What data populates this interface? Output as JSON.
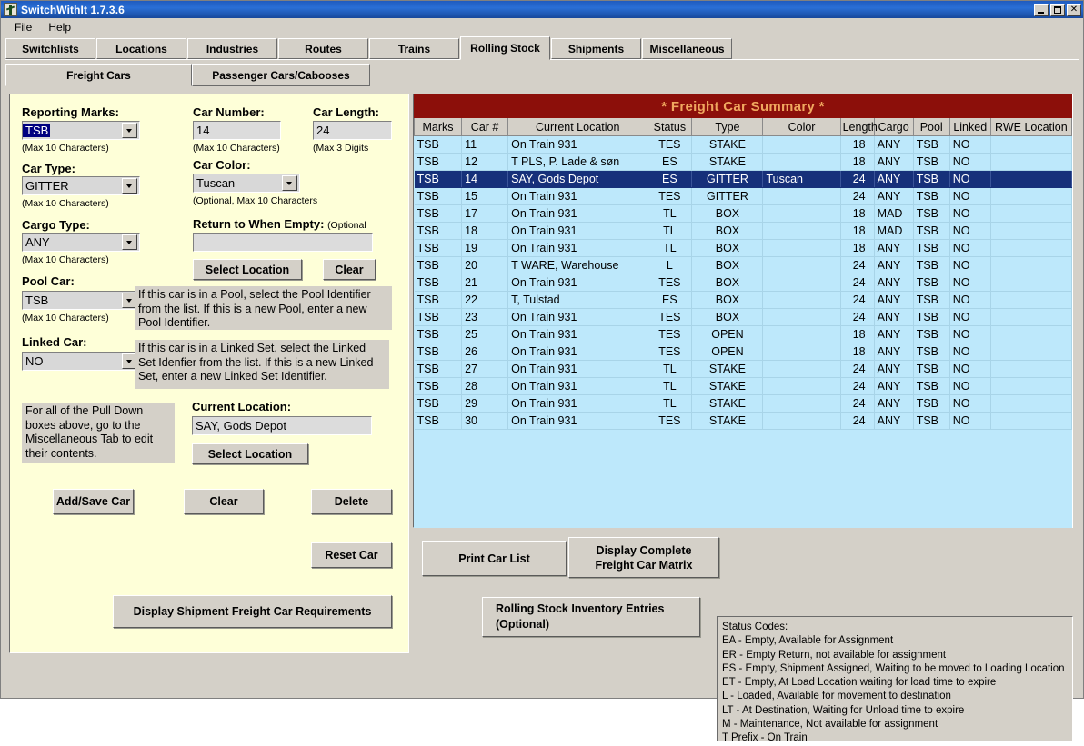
{
  "window": {
    "title": "SwitchWithIt 1.7.3.6",
    "icon": "app-icon",
    "buttons": {
      "minimize": "_",
      "maximize": "□",
      "close": "✕"
    }
  },
  "menu": {
    "items": [
      "File",
      "Help"
    ]
  },
  "tabs": {
    "items": [
      {
        "label": "Switchlists",
        "active": false
      },
      {
        "label": "Locations",
        "active": false
      },
      {
        "label": "Industries",
        "active": false
      },
      {
        "label": "Routes",
        "active": false
      },
      {
        "label": "Trains",
        "active": false
      },
      {
        "label": "Rolling Stock",
        "active": true
      },
      {
        "label": "Shipments",
        "active": false
      },
      {
        "label": "Miscellaneous",
        "active": false
      }
    ]
  },
  "subtabs": {
    "items": [
      {
        "label": "Freight Cars",
        "active": true
      },
      {
        "label": "Passenger Cars/Cabooses",
        "active": false
      }
    ]
  },
  "form": {
    "reporting_marks": {
      "label": "Reporting Marks:",
      "value": "TSB",
      "hint": "(Max 10 Characters)"
    },
    "car_number": {
      "label": "Car Number:",
      "value": "14",
      "hint": "(Max 10 Characters)"
    },
    "car_length": {
      "label": "Car Length:",
      "value": "24",
      "hint": "(Max 3 Digits"
    },
    "car_type": {
      "label": "Car Type:",
      "value": "GITTER",
      "hint": "(Max 10 Characters)"
    },
    "car_color": {
      "label": "Car Color:",
      "value": "Tuscan",
      "hint": "(Optional, Max 10 Characters"
    },
    "cargo_type": {
      "label": "Cargo Type:",
      "value": "ANY",
      "hint": "(Max 10 Characters)"
    },
    "return_when_empty": {
      "label": "Return to When Empty:",
      "label_optional": "(Optional",
      "value": ""
    },
    "rwe_select_location": "Select Location",
    "rwe_clear": "Clear",
    "pool_car": {
      "label": "Pool Car:",
      "value": "TSB",
      "hint": "(Max 10 Characters)"
    },
    "pool_car_info": "If this car is in a Pool, select the Pool Identifier from the list.  If this is a new Pool, enter a new Pool Identifier.",
    "linked_car": {
      "label": "Linked Car:",
      "value": "NO"
    },
    "linked_car_info": "If this car is in a Linked Set, select the Linked Set Idenfier from the list.  If this is a new Linked Set, enter a new Linked Set Identifier.",
    "pulldown_info": "For all of the Pull Down boxes above, go to the Miscellaneous Tab to edit their contents.",
    "current_location": {
      "label": "Current Location:",
      "value": "SAY, Gods Depot"
    },
    "current_select_location": "Select Location"
  },
  "buttons": {
    "add_save_car": "Add/Save Car",
    "clear": "Clear",
    "delete": "Delete",
    "reset_car": "Reset Car",
    "print_car_list": "Print Car List",
    "display_matrix_line1": "Display Complete",
    "display_matrix_line2": "Freight Car Matrix",
    "display_shipment_req": "Display Shipment Freight Car Requirements",
    "rolling_stock_line1": "Rolling Stock Inventory Entries",
    "rolling_stock_line2": "(Optional)"
  },
  "table": {
    "title": "* Freight Car Summary *",
    "columns": [
      "Marks",
      "Car #",
      "Current Location",
      "Status",
      "Type",
      "Color",
      "Length",
      "Cargo",
      "Pool",
      "Linked",
      "RWE Location"
    ],
    "selected_index": 2,
    "rows": [
      {
        "marks": "TSB",
        "car": "11",
        "location": "On Train 931",
        "status": "TES",
        "type": "STAKE",
        "color": "",
        "length": "18",
        "cargo": "ANY",
        "pool": "TSB",
        "linked": "NO",
        "rwe": ""
      },
      {
        "marks": "TSB",
        "car": "12",
        "location": "T PLS, P. Lade & søn",
        "status": "ES",
        "type": "STAKE",
        "color": "",
        "length": "18",
        "cargo": "ANY",
        "pool": "TSB",
        "linked": "NO",
        "rwe": ""
      },
      {
        "marks": "TSB",
        "car": "14",
        "location": "SAY, Gods Depot",
        "status": "ES",
        "type": "GITTER",
        "color": "Tuscan",
        "length": "24",
        "cargo": "ANY",
        "pool": "TSB",
        "linked": "NO",
        "rwe": ""
      },
      {
        "marks": "TSB",
        "car": "15",
        "location": "On Train 931",
        "status": "TES",
        "type": "GITTER",
        "color": "",
        "length": "24",
        "cargo": "ANY",
        "pool": "TSB",
        "linked": "NO",
        "rwe": ""
      },
      {
        "marks": "TSB",
        "car": "17",
        "location": "On Train 931",
        "status": "TL",
        "type": "BOX",
        "color": "",
        "length": "18",
        "cargo": "MAD",
        "pool": "TSB",
        "linked": "NO",
        "rwe": ""
      },
      {
        "marks": "TSB",
        "car": "18",
        "location": "On Train 931",
        "status": "TL",
        "type": "BOX",
        "color": "",
        "length": "18",
        "cargo": "MAD",
        "pool": "TSB",
        "linked": "NO",
        "rwe": ""
      },
      {
        "marks": "TSB",
        "car": "19",
        "location": "On Train 931",
        "status": "TL",
        "type": "BOX",
        "color": "",
        "length": "18",
        "cargo": "ANY",
        "pool": "TSB",
        "linked": "NO",
        "rwe": ""
      },
      {
        "marks": "TSB",
        "car": "20",
        "location": "T WARE, Warehouse",
        "status": "L",
        "type": "BOX",
        "color": "",
        "length": "24",
        "cargo": "ANY",
        "pool": "TSB",
        "linked": "NO",
        "rwe": ""
      },
      {
        "marks": "TSB",
        "car": "21",
        "location": "On Train 931",
        "status": "TES",
        "type": "BOX",
        "color": "",
        "length": "24",
        "cargo": "ANY",
        "pool": "TSB",
        "linked": "NO",
        "rwe": ""
      },
      {
        "marks": "TSB",
        "car": "22",
        "location": "T, Tulstad",
        "status": "ES",
        "type": "BOX",
        "color": "",
        "length": "24",
        "cargo": "ANY",
        "pool": "TSB",
        "linked": "NO",
        "rwe": ""
      },
      {
        "marks": "TSB",
        "car": "23",
        "location": "On Train 931",
        "status": "TES",
        "type": "BOX",
        "color": "",
        "length": "24",
        "cargo": "ANY",
        "pool": "TSB",
        "linked": "NO",
        "rwe": ""
      },
      {
        "marks": "TSB",
        "car": "25",
        "location": "On Train 931",
        "status": "TES",
        "type": "OPEN",
        "color": "",
        "length": "18",
        "cargo": "ANY",
        "pool": "TSB",
        "linked": "NO",
        "rwe": ""
      },
      {
        "marks": "TSB",
        "car": "26",
        "location": "On Train 931",
        "status": "TES",
        "type": "OPEN",
        "color": "",
        "length": "18",
        "cargo": "ANY",
        "pool": "TSB",
        "linked": "NO",
        "rwe": ""
      },
      {
        "marks": "TSB",
        "car": "27",
        "location": "On Train 931",
        "status": "TL",
        "type": "STAKE",
        "color": "",
        "length": "24",
        "cargo": "ANY",
        "pool": "TSB",
        "linked": "NO",
        "rwe": ""
      },
      {
        "marks": "TSB",
        "car": "28",
        "location": "On Train 931",
        "status": "TL",
        "type": "STAKE",
        "color": "",
        "length": "24",
        "cargo": "ANY",
        "pool": "TSB",
        "linked": "NO",
        "rwe": ""
      },
      {
        "marks": "TSB",
        "car": "29",
        "location": "On Train 931",
        "status": "TL",
        "type": "STAKE",
        "color": "",
        "length": "24",
        "cargo": "ANY",
        "pool": "TSB",
        "linked": "NO",
        "rwe": ""
      },
      {
        "marks": "TSB",
        "car": "30",
        "location": "On Train 931",
        "status": "TES",
        "type": "STAKE",
        "color": "",
        "length": "24",
        "cargo": "ANY",
        "pool": "TSB",
        "linked": "NO",
        "rwe": ""
      }
    ]
  },
  "status_codes": {
    "heading": "Status Codes:",
    "lines": [
      "EA - Empty, Available for Assignment",
      "ER - Empty Return, not available for assignment",
      "ES - Empty, Shipment Assigned, Waiting to be moved to Loading Location",
      "ET - Empty, At Load Location waiting for load time to expire",
      "L - Loaded, Available for movement to destination",
      "LT - At Destination, Waiting for Unload time to expire",
      "M - Maintenance, Not available for assignment",
      "T Prefix - On Train"
    ]
  },
  "colors": {
    "panel_bg": "#feffd8",
    "table_header_bg": "#8c0f0a",
    "table_header_fg": "#f0a85f",
    "row_bg": "#bde8fb",
    "row_selected_bg": "#16307a",
    "chrome": "#d4d0c8"
  }
}
